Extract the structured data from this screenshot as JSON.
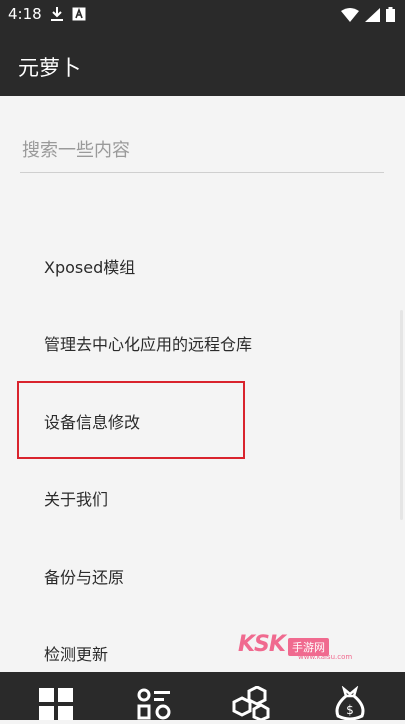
{
  "status": {
    "time": "4:18",
    "icons": [
      "download-icon",
      "notification-a-icon",
      "wifi-icon",
      "signal-icon",
      "battery-icon"
    ]
  },
  "app": {
    "title": "元萝卜"
  },
  "search": {
    "placeholder": "搜索一些内容",
    "value": ""
  },
  "menu": {
    "items": [
      {
        "label": "Xposed模组"
      },
      {
        "label": "管理去中心化应用的远程仓库"
      },
      {
        "label": "设备信息修改"
      },
      {
        "label": "关于我们"
      },
      {
        "label": "备份与还原"
      },
      {
        "label": "检测更新"
      }
    ]
  },
  "watermark": {
    "brand": "KSK",
    "badge": "手游网",
    "sub": "www.kaisu.com"
  },
  "bottom_nav": {
    "icons": [
      "grid-icon",
      "modules-icon",
      "hexagon-settings-icon",
      "money-bag-icon"
    ]
  },
  "colors": {
    "bar": "#2a2a2a",
    "background": "#f4f4f4",
    "highlight": "#d9232d",
    "watermark": "#f06a8f"
  }
}
